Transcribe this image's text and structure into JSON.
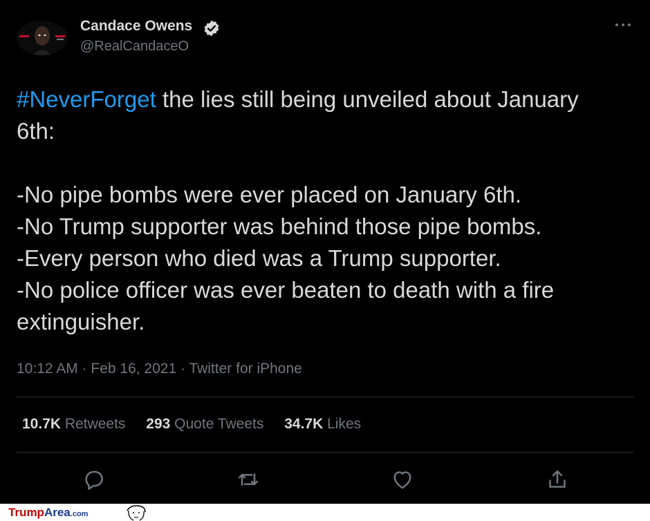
{
  "tweet": {
    "author": {
      "display_name": "Candace Owens",
      "handle": "@RealCandaceO",
      "verified": true,
      "avatar_icon": "avatar"
    },
    "hashtag": "#NeverForget",
    "intro": " the lies still being unveiled about January",
    "intro_cont": "6th:",
    "lines": [
      "-No pipe bombs were ever placed on January 6th.",
      "-No Trump supporter was behind those pipe bombs.",
      "-Every person who died was a Trump supporter.",
      "-No police officer was ever beaten to death with a fire",
      "extinguisher."
    ],
    "meta": "10:12 AM · Feb 16, 2021 · Twitter for iPhone",
    "stats": {
      "retweets_count": "10.7K",
      "retweets_label": "Retweets",
      "quotes_count": "293",
      "quotes_label": "Quote Tweets",
      "likes_count": "34.7K",
      "likes_label": "Likes"
    },
    "actions": [
      "reply-icon",
      "retweet-icon",
      "like-icon",
      "share-icon"
    ]
  },
  "colors": {
    "background": "#000000",
    "text": "#d9d9d9",
    "muted": "#6e767d",
    "link": "#1d9bf0",
    "divider": "#2f3336"
  },
  "footer": {
    "brand_part1": "Trump",
    "brand_part2": "Area",
    "brand_part3": ".com"
  }
}
